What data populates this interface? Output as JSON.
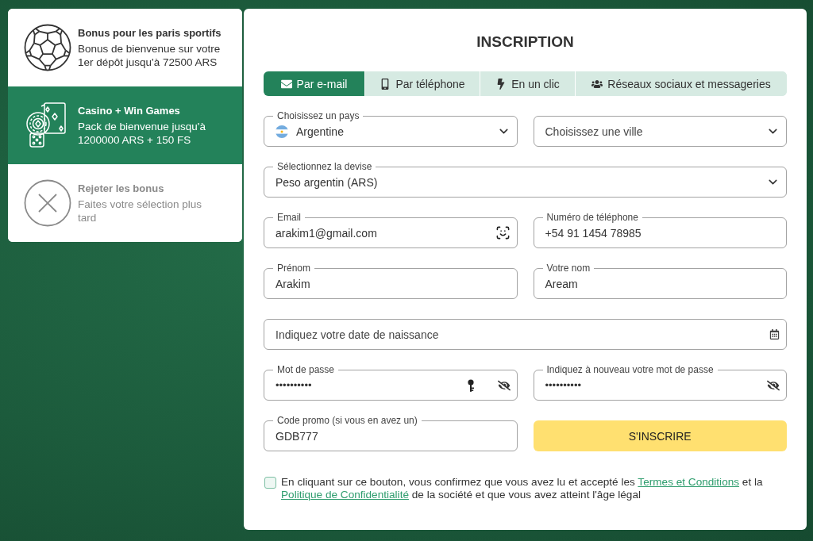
{
  "bonuses": [
    {
      "kind": "sport",
      "title": "Bonus pour les paris sportifs",
      "description": "Bonus de bienvenue sur votre 1er dépôt jusqu'à 72500 ARS",
      "selected": false
    },
    {
      "kind": "casino",
      "title": "Casino + Win Games",
      "description": "Pack de bienvenue jusqu'à 1200000 ARS + 150 FS",
      "selected": true
    },
    {
      "kind": "reject",
      "title": "Rejeter les bonus",
      "description": "Faites votre sélection plus tard",
      "selected": false
    }
  ],
  "form": {
    "title": "INSCRIPTION",
    "tabs": [
      {
        "kind": "email",
        "label": "Par e-mail",
        "selected": true
      },
      {
        "kind": "phone",
        "label": "Par téléphone",
        "selected": false
      },
      {
        "kind": "oneclick",
        "label": "En un clic",
        "selected": false
      },
      {
        "kind": "social",
        "label": "Réseaux sociaux et messageries",
        "selected": false
      }
    ],
    "rows": [
      [
        {
          "kind": "country",
          "label": "Choisissez un pays",
          "value": "Argentine"
        },
        {
          "kind": "select",
          "placeholder": "Choisissez une ville"
        }
      ],
      [
        {
          "kind": "select",
          "label": "Sélectionnez la devise",
          "value": "Peso argentin (ARS)"
        }
      ],
      [
        {
          "kind": "email",
          "label": "Email",
          "value": "arakim1@gmail.com"
        },
        {
          "kind": "text",
          "label": "Numéro de téléphone",
          "value": "+54 91 1454 78985"
        }
      ],
      [
        {
          "kind": "text",
          "label": "Prénom",
          "value": "Arakim"
        },
        {
          "kind": "text",
          "label": "Votre nom",
          "value": "Aream"
        }
      ],
      [
        {
          "kind": "date",
          "placeholder": "Indiquez votre date de naissance"
        }
      ],
      [
        {
          "kind": "password",
          "label": "Mot de passe",
          "value": "••••••••••",
          "saved": true
        },
        {
          "kind": "password",
          "label": "Indiquez à nouveau votre mot de passe",
          "value": "••••••••••",
          "saved": false
        }
      ],
      [
        {
          "kind": "text",
          "label": "Code promo (si vous en avez un)",
          "value": "GDB777"
        },
        {
          "kind": "submit",
          "label": "S'INSCRIRE"
        }
      ]
    ],
    "consent": {
      "checked": false,
      "parts": [
        {
          "kind": "text",
          "text": "En cliquant sur ce bouton, vous confirmez que vous avez lu et accepté les "
        },
        {
          "kind": "link",
          "text": "Termes et Conditions"
        },
        {
          "kind": "text",
          "text": " et la "
        },
        {
          "kind": "link",
          "text": "Politique de Confidentialité"
        },
        {
          "kind": "text",
          "text": " de la société et que vous avez atteint l'âge légal"
        }
      ]
    }
  }
}
